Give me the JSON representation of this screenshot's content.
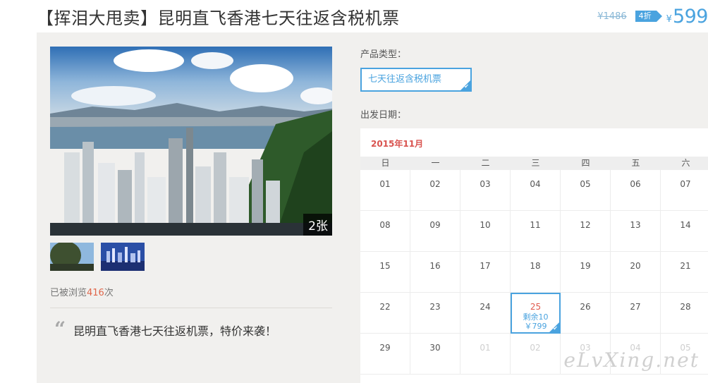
{
  "product": {
    "title": "【挥泪大甩卖】昆明直飞香港七天往返含税机票",
    "original_price": "¥1486",
    "discount": "4折",
    "currency": "¥",
    "current_price": "599"
  },
  "gallery": {
    "photo_count": "2张",
    "views_prefix": "已被浏览",
    "views_count": "416",
    "views_suffix": "次",
    "quote_mark": "“",
    "description": "昆明直飞香港七天往返机票，特价来袭！"
  },
  "options": {
    "type_label": "产品类型：",
    "type_option": "七天往返含税机票",
    "date_label": "出发日期："
  },
  "calendar": {
    "month": "2015年11月",
    "weekdays": [
      "日",
      "一",
      "二",
      "三",
      "四",
      "五",
      "六"
    ],
    "rows": [
      [
        "01",
        "02",
        "03",
        "04",
        "05",
        "06",
        "07"
      ],
      [
        "08",
        "09",
        "10",
        "11",
        "12",
        "13",
        "14"
      ],
      [
        "15",
        "16",
        "17",
        "18",
        "19",
        "20",
        "21"
      ],
      [
        "22",
        "23",
        "24",
        "25",
        "26",
        "27",
        "28"
      ],
      [
        "29",
        "30",
        "01",
        "02",
        "03",
        "04",
        "05"
      ]
    ],
    "selected": {
      "day": "25",
      "remaining": "剩余10",
      "price": "￥799"
    }
  },
  "watermark": "eLvXing.net",
  "colors": {
    "accent": "#4aa3df",
    "date_red": "#e05a4e",
    "panel": "#f1f0ee"
  }
}
